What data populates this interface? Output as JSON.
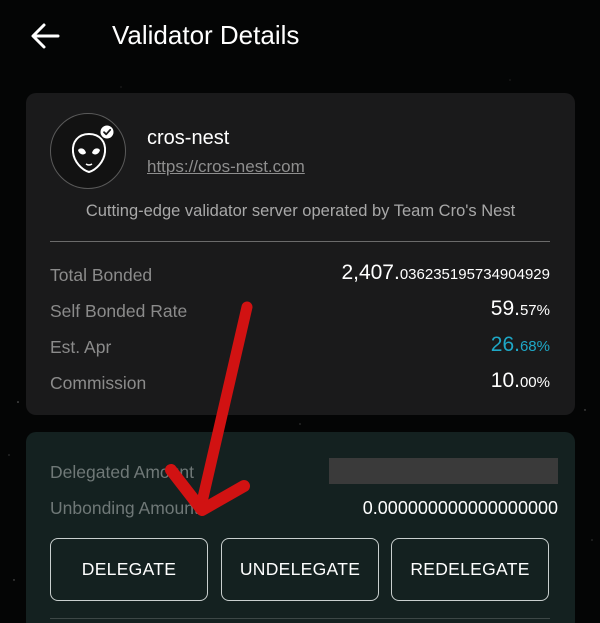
{
  "header": {
    "title": "Validator Details",
    "back_icon": "arrow-left-icon"
  },
  "validator": {
    "name": "cros-nest",
    "url": "https://cros-nest.com",
    "description": "Cutting-edge validator server operated by Team Cro's Nest",
    "avatar_icon": "alien-head-icon",
    "verified_icon": "check-badge-icon"
  },
  "stats": [
    {
      "label": "Total Bonded",
      "value_main": "2,407.",
      "value_small": "036235195734904929"
    },
    {
      "label": "Self Bonded Rate",
      "value_main": "59.",
      "value_small": "57%"
    },
    {
      "label": "Est. Apr",
      "value_main": "26.",
      "value_small": "68%"
    },
    {
      "label": "Commission",
      "value_main": "10.",
      "value_small": "00%"
    }
  ],
  "delegation": {
    "delegated_label": "Delegated Amount",
    "unbonding_label": "Unbonding Amount",
    "unbonding_value": "0.000000000000000000"
  },
  "actions": {
    "delegate": "DELEGATE",
    "undelegate": "UNDELEGATE",
    "redelegate": "REDELEGATE"
  },
  "colors": {
    "background": "#040505",
    "card": "#1a1a1b",
    "card_secondary": "#142120",
    "accent": "#1ea7c6",
    "annotation_arrow": "#d11212"
  }
}
